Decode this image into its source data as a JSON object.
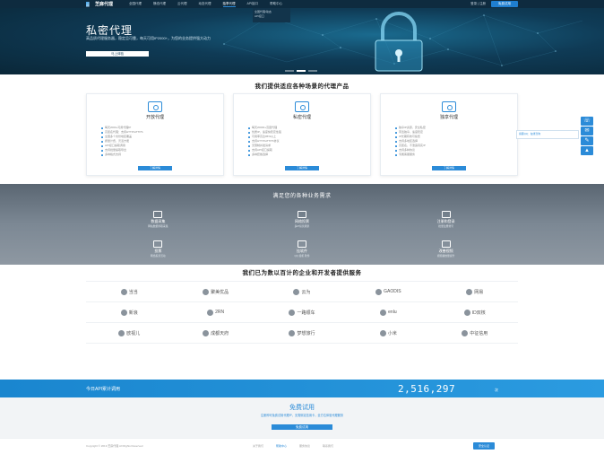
{
  "nav": {
    "logo_text": "芝麻代理",
    "items": [
      "全国代理",
      "静态代理",
      "云代理",
      "动态代理",
      "独享代理",
      "API接口",
      "帮助中心"
    ],
    "active_index": 4,
    "right_text": "登录 | 注册",
    "right_button": "免费试用"
  },
  "dropdown": {
    "items": [
      "全国代理/动态",
      "API接口"
    ]
  },
  "hero": {
    "title": "私密代理",
    "subtitle": "高品质代理服务器，稳定且可靠，每天可用IP2000+，为您的业务提供强大动力",
    "button": "马上体验"
  },
  "products": {
    "title": "我们提供适应各种场景的代理产品",
    "cards": [
      {
        "name": "开放代理",
        "features": [
          "每天2000+可用代理IP",
          "高匿名代理：支持HTTP/HTTPS",
          "全国多个省份地区覆盖",
          "按量计费，灵活方便",
          "API接口提取调用",
          "支持批量提取导出",
          "多种格式支持"
        ],
        "button": "了解详情"
      },
      {
        "name": "私密代理",
        "features": [
          "每天20000+高匿代理",
          "优质IP，速度快稳定性强",
          "可用率高达95%以上",
          "支持HTTP/HTTPS协议",
          "无限制并发请求",
          "支持API接口提取",
          "多种套餐选择"
        ],
        "button": "了解详情"
      },
      {
        "name": "独享代理",
        "features": [
          "独享IP资源，安全私密",
          "带宽独享，速度稳定",
          "IP长期有效可续费",
          "支持多地区选择",
          "高匿名，不泄露真实IP",
          "支持多种协议",
          "专属客服服务"
        ],
        "button": "了解详情"
      }
    ]
  },
  "side": {
    "popup_text": "客服QQ：在线咨询",
    "tools": [
      "☏",
      "✉",
      "✎",
      "▲"
    ]
  },
  "business": {
    "title": "满足您的各种业务需求",
    "items": [
      {
        "name": "数据采集",
        "desc": "网站数据抓取采集"
      },
      {
        "name": "网络投票",
        "desc": "多IP投票刷票"
      },
      {
        "name": "注册和登录",
        "desc": "批量注册账号"
      },
      {
        "name": "投票",
        "desc": "网络投票活动"
      },
      {
        "name": "挂软件",
        "desc": "QQ 挂机 软件"
      },
      {
        "name": "改善视频",
        "desc": "视频播放量提升"
      }
    ]
  },
  "clients": {
    "title": "我们已为数以百计的企业和开发者提供服务",
    "items": [
      "当当",
      "聚美优品",
      "云为",
      "GAODIS",
      "网易",
      "新浪",
      "2RN",
      "一路顺车",
      "enlu",
      "ID双核",
      "欧视儿",
      "成都天府",
      "梦想旅行",
      "小米",
      "中征信用"
    ]
  },
  "api": {
    "label": "今日API累计调用",
    "value": "2,516,297",
    "unit": "次"
  },
  "trial": {
    "title": "免费试用",
    "desc": "注册即可免费试用代理IP，无需绑定信用卡，全方位体验代理服务",
    "button": "免费试用"
  },
  "footer": {
    "copyright": "Copyright © 2019 芝麻代理 All Rights Reserved",
    "links": [
      "关于我们",
      "帮助中心",
      "服务协议",
      "联系我们"
    ],
    "active_link": 1,
    "badge": "安全认证"
  },
  "colors": {
    "accent": "#2b8bd8",
    "nav_bg": "#0e2b3f"
  }
}
